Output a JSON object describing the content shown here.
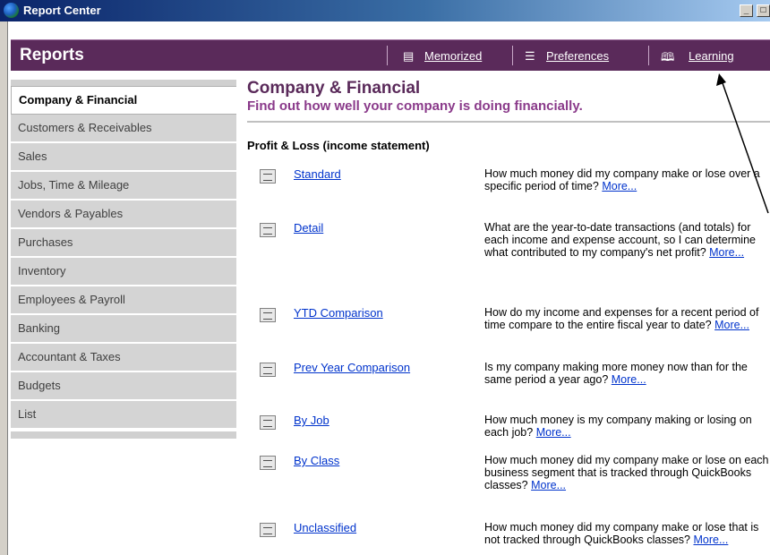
{
  "window": {
    "title": "Report Center"
  },
  "header": {
    "title": "Reports",
    "links": [
      {
        "label": "Memorized",
        "icon": "memorized-icon"
      },
      {
        "label": "Preferences",
        "icon": "preferences-icon"
      },
      {
        "label": "Learning",
        "icon": "book-icon"
      }
    ]
  },
  "sidebar": {
    "items": [
      {
        "label": "Company & Financial",
        "active": true
      },
      {
        "label": "Customers & Receivables"
      },
      {
        "label": "Sales"
      },
      {
        "label": "Jobs, Time & Mileage"
      },
      {
        "label": "Vendors & Payables"
      },
      {
        "label": "Purchases"
      },
      {
        "label": "Inventory"
      },
      {
        "label": "Employees & Payroll"
      },
      {
        "label": "Banking"
      },
      {
        "label": "Accountant & Taxes"
      },
      {
        "label": "Budgets"
      },
      {
        "label": "List"
      }
    ]
  },
  "main": {
    "title": "Company & Financial",
    "subtitle": "Find out how well your company is doing financially.",
    "section": "Profit & Loss (income statement)",
    "more_label": "More...",
    "reports": [
      {
        "name": "Standard",
        "description": "How much money did my company make or lose over a specific period of time?"
      },
      {
        "name": "Detail",
        "description": "What are the year-to-date transactions (and totals) for each income and expense account, so I can determine what contributed to my company's net profit?"
      },
      {
        "name": "YTD Comparison",
        "description": "How do my income and expenses for a recent period of time compare to the entire fiscal year to date?"
      },
      {
        "name": "Prev Year Comparison",
        "description": "Is my company making more money now than for the same period a year ago?"
      },
      {
        "name": "By Job",
        "description": "How much money is my company making or losing on each job?"
      },
      {
        "name": "By Class",
        "description": "How much money did my company make or lose on each business segment that is tracked through QuickBooks classes?"
      },
      {
        "name": "Unclassified",
        "description": "How much money did my company make or lose that is not tracked through QuickBooks classes?"
      }
    ]
  }
}
